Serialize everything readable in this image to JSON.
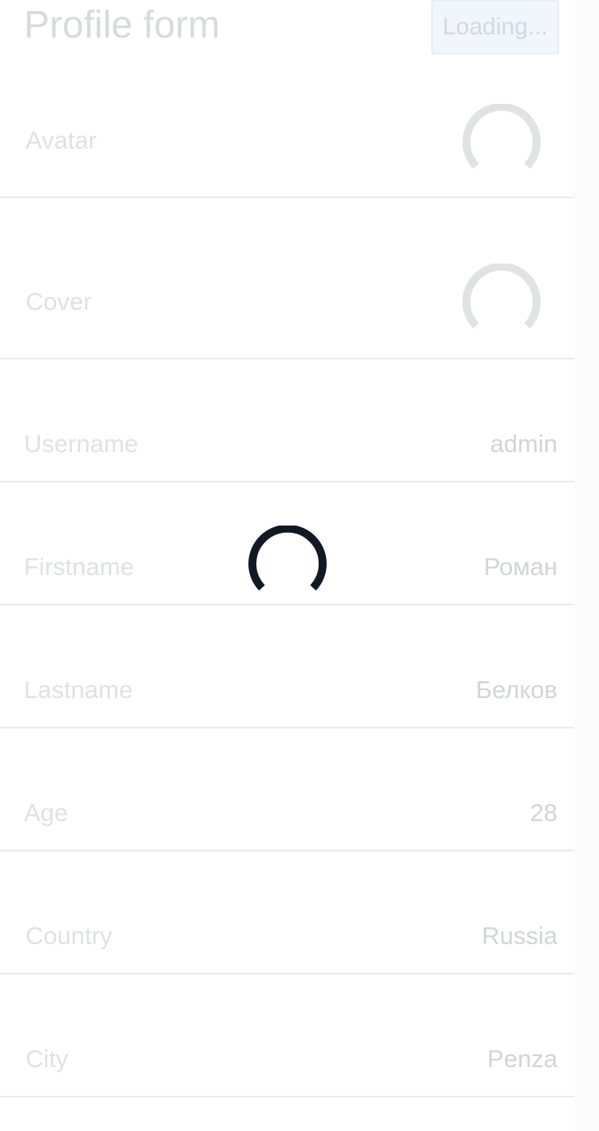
{
  "header": {
    "title": "Profile form",
    "loading_button_label": "Loading..."
  },
  "form": {
    "avatar_label": "Avatar",
    "cover_label": "Cover",
    "fields": [
      {
        "label": "Username",
        "value": "admin"
      },
      {
        "label": "Firstname",
        "value": "Роман"
      },
      {
        "label": "Lastname",
        "value": "Белков"
      },
      {
        "label": "Age",
        "value": "28"
      },
      {
        "label": "Country",
        "value": "Russia"
      },
      {
        "label": "City",
        "value": "Penza"
      }
    ]
  },
  "colors": {
    "overlay_spinner": "#121826",
    "row_spinner": "#b4b6ba"
  },
  "icons": {
    "row_spinner": "spinner-icon",
    "overlay_spinner": "loading-spinner-icon"
  }
}
